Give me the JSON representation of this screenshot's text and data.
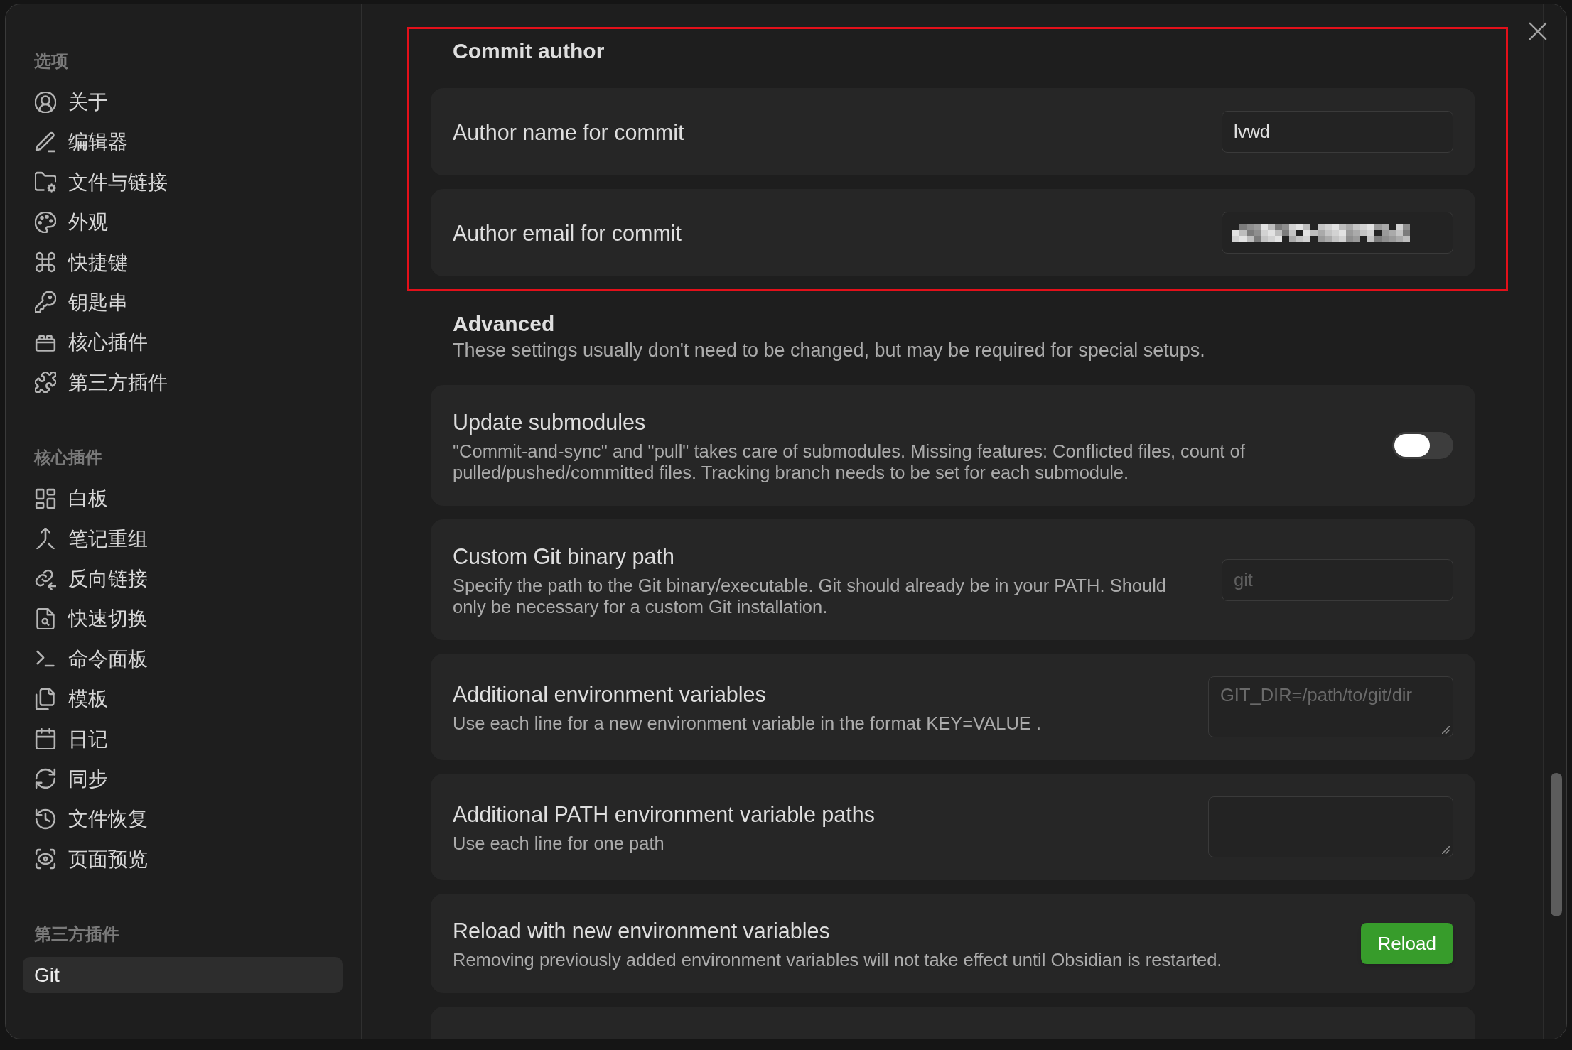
{
  "sidebar": {
    "groups": [
      {
        "heading": "选项",
        "items": [
          {
            "label": "关于",
            "selected": false
          },
          {
            "label": "编辑器",
            "selected": false
          },
          {
            "label": "文件与链接",
            "selected": false
          },
          {
            "label": "外观",
            "selected": false
          },
          {
            "label": "快捷键",
            "selected": false
          },
          {
            "label": "钥匙串",
            "selected": false
          },
          {
            "label": "核心插件",
            "selected": false
          },
          {
            "label": "第三方插件",
            "selected": false
          }
        ]
      },
      {
        "heading": "核心插件",
        "items": [
          {
            "label": "白板",
            "selected": false
          },
          {
            "label": "笔记重组",
            "selected": false
          },
          {
            "label": "反向链接",
            "selected": false
          },
          {
            "label": "快速切换",
            "selected": false
          },
          {
            "label": "命令面板",
            "selected": false
          },
          {
            "label": "模板",
            "selected": false
          },
          {
            "label": "日记",
            "selected": false
          },
          {
            "label": "同步",
            "selected": false
          },
          {
            "label": "文件恢复",
            "selected": false
          },
          {
            "label": "页面预览",
            "selected": false
          }
        ]
      },
      {
        "heading": "第三方插件",
        "items": [
          {
            "label": "Git",
            "selected": true
          }
        ]
      }
    ]
  },
  "content": {
    "sections": [
      {
        "heading": "Commit author",
        "highlighted": true,
        "settings": [
          {
            "kind": "text",
            "name": "Author name for commit",
            "value": "lvwd",
            "redacted": false
          },
          {
            "kind": "text",
            "name": "Author email for commit",
            "redacted": true
          }
        ]
      },
      {
        "heading": "Advanced",
        "description": "These settings usually don't need to be changed, but may be required for special setups.",
        "highlighted": false,
        "settings": [
          {
            "kind": "toggle",
            "name": "Update submodules",
            "description": "\"Commit-and-sync\" and \"pull\" takes care of submodules. Missing features: Conflicted files, count of pulled/pushed/committed files. Tracking branch needs to be set for each submodule.",
            "on": false
          },
          {
            "kind": "text",
            "name": "Custom Git binary path",
            "description": "Specify the path to the Git binary/executable. Git should already be in your PATH. Should only be necessary for a custom Git installation.",
            "placeholder": "git",
            "redacted": false
          },
          {
            "kind": "textarea",
            "name": "Additional environment variables",
            "description": "Use each line for a new environment variable in the format KEY=VALUE .",
            "placeholder": "GIT_DIR=/path/to/git/dir"
          },
          {
            "kind": "textarea",
            "name": "Additional PATH environment variable paths",
            "description": "Use each line for one path"
          },
          {
            "kind": "button",
            "name": "Reload with new environment variables",
            "description": "Removing previously added environment variables will not take effect until Obsidian is restarted.",
            "button": "Reload"
          }
        ]
      }
    ],
    "more_below": true
  }
}
